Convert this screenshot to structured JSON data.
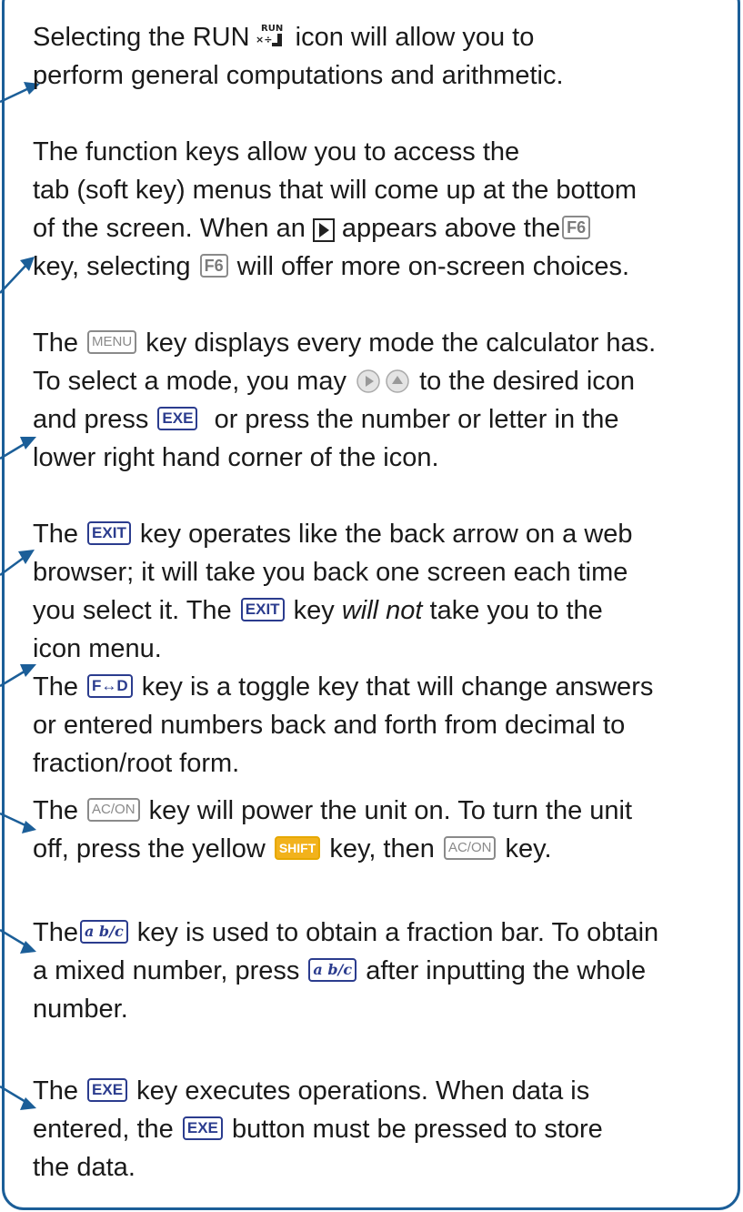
{
  "colors": {
    "border": "#1b5e98",
    "arrow": "#1b5e98",
    "key_blue": "#2b3c8e",
    "key_gray": "#8a8a8a",
    "shift_yellow": "#f2b21c"
  },
  "icons": {
    "run": {
      "name": "run-mode-icon",
      "label_top": "RUN",
      "label_bottom": "×÷"
    },
    "more_tabs": "right-triangle-icon",
    "right": "cursor-right-icon",
    "up": "cursor-up-icon"
  },
  "keys": {
    "f6": "F6",
    "menu": "MENU",
    "exe": "EXE",
    "exit": "EXIT",
    "fd": "F↔D",
    "acon": "AC/ON",
    "shift": "SHIFT",
    "frac": "a b/c"
  },
  "p1": {
    "a": "Selecting the RUN",
    "b": " icon will allow you to",
    "line2": "perform general computations and arithmetic."
  },
  "p2": {
    "line1": "The function keys allow you to access the",
    "line2": "tab (soft key) menus that will come up at the bottom",
    "line3a": "of the screen. When an",
    "line3b": "appears above the",
    "line4a": "key, selecting",
    "line4b": " will offer more on-screen choices."
  },
  "p3": {
    "line1a": "The",
    "line1b": " key displays every mode the calculator has.",
    "line2a": "To select a mode, you may",
    "line2b": " to the desired icon",
    "line3a": "and press",
    "line3b": "  or press the number or letter in the",
    "line4": "lower right hand corner of the icon."
  },
  "p4": {
    "line1a": "The",
    "line1b": " key operates like the back arrow on a web",
    "line2": "browser; it will take you back one screen each time",
    "line3a": "you select it. The",
    "line3b": " key ",
    "line3c": "will not",
    "line3d": " take you to the",
    "line4": "icon menu."
  },
  "p5": {
    "line1a": "The",
    "line1b": " key is a toggle key that will change answers",
    "line2": "or entered numbers back and forth from decimal to",
    "line3": "fraction/root form."
  },
  "p6": {
    "line1a": "The",
    "line1b": " key will power the unit on. To turn the unit",
    "line2a": "off, press the yellow",
    "line2b": " key, then",
    "line2c": " key."
  },
  "p7": {
    "line1a": "The",
    "line1b": " key is used to obtain a fraction bar. To obtain",
    "line2a": "a mixed number, press",
    "line2b": " after inputting the whole",
    "line3": "number."
  },
  "p8": {
    "line1a": "The",
    "line1b": " key executes operations. When data is",
    "line2a": "entered, the",
    "line2b": " button must be pressed to store",
    "line3": "the data."
  }
}
